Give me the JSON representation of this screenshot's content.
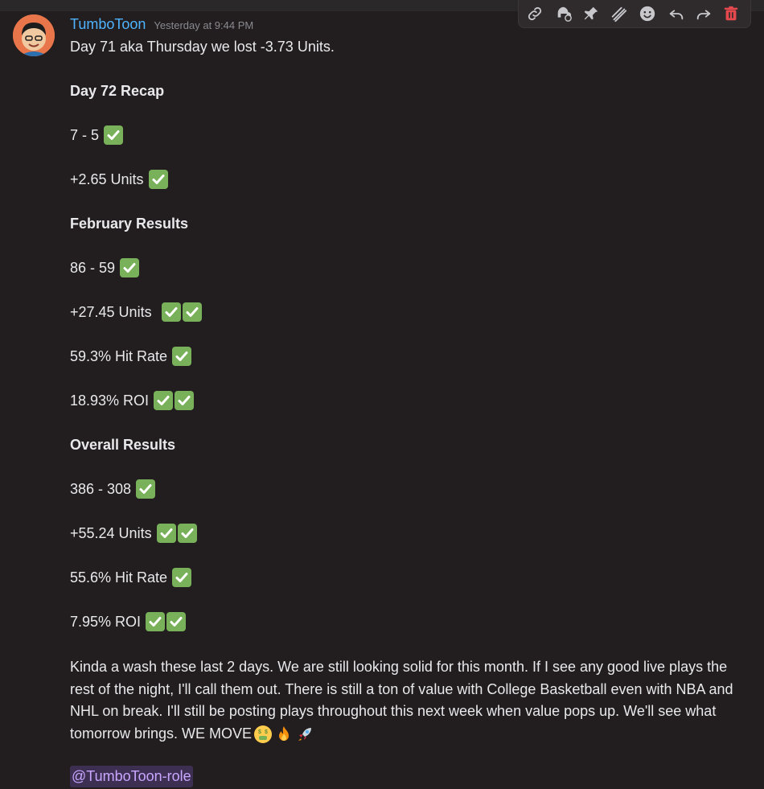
{
  "message": {
    "username": "TumboToon",
    "timestamp": "Yesterday at 9:44 PM",
    "line1": "Day 71 aka Thursday we lost -3.73 Units.",
    "day72_heading": "Day 72 Recap",
    "day72_record": "7 - 5",
    "day72_units": "+2.65 Units",
    "feb_heading": "February Results",
    "feb_record": "86 - 59",
    "feb_units": "+27.45 Units",
    "feb_hit": "59.3% Hit Rate",
    "feb_roi": "18.93% ROI",
    "overall_heading": "Overall Results",
    "overall_record": "386 - 308",
    "overall_units": "+55.24 Units",
    "overall_hit": "55.6% Hit Rate",
    "overall_roi": "7.95% ROI",
    "paragraph": "Kinda a wash these last 2 days. We are still looking solid for this month. If I see any good live plays the rest of the night, I'll call them out. There is still a ton of value with College Basketball even with NBA and NHL on break. I'll still be posting plays throughout this next week when value pops up. We'll see what tomorrow brings. WE MOVE",
    "mention": "@TumboToon-role"
  },
  "toolbar_icons": [
    "link-icon",
    "thread-icon",
    "pin-icon",
    "mark-icon",
    "emoji-icon",
    "reply-icon",
    "forward-icon",
    "trash-icon"
  ],
  "colors": {
    "background": "#221e1f",
    "username": "#4fb3ff",
    "check_green": "#78b159",
    "mention_text": "#c9a6ff",
    "mention_bg": "#3c2f52",
    "delete_red": "#e5484d"
  }
}
